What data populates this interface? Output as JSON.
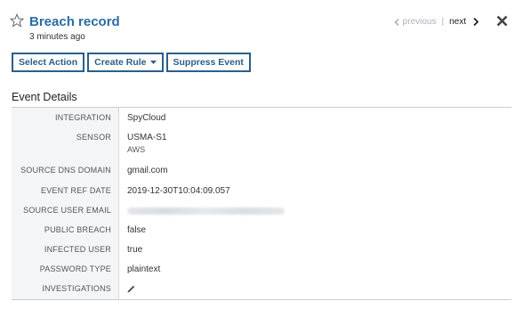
{
  "header": {
    "title": "Breach record",
    "subtitle": "3 minutes ago",
    "pager": {
      "previous": "previous",
      "separator": "|",
      "next": "next"
    }
  },
  "toolbar": {
    "select_action": "Select Action",
    "create_rule": "Create Rule",
    "suppress_event": "Suppress Event"
  },
  "section": {
    "title": "Event Details"
  },
  "details": [
    {
      "label": "INTEGRATION",
      "value": "SpyCloud"
    },
    {
      "label": "SENSOR",
      "value": "USMA-S1",
      "sub": "AWS"
    },
    {
      "label": "SOURCE DNS DOMAIN",
      "value": "gmail.com"
    },
    {
      "label": "EVENT REF DATE",
      "value": "2019-12-30T10:04:09.057"
    },
    {
      "label": "SOURCE USER EMAIL",
      "value": ""
    },
    {
      "label": "PUBLIC BREACH",
      "value": "false"
    },
    {
      "label": "INFECTED USER",
      "value": "true"
    },
    {
      "label": "PASSWORD TYPE",
      "value": "plaintext"
    },
    {
      "label": "INVESTIGATIONS",
      "value": ""
    }
  ],
  "icons": {
    "star": "star-outline-icon",
    "prev": "chevron-left-icon",
    "next": "chevron-right-icon",
    "close": "close-icon",
    "caret": "caret-down-icon",
    "edit": "pencil-icon"
  },
  "colors": {
    "accent": "#2b6ca3",
    "button_border": "#2b5f8a"
  }
}
